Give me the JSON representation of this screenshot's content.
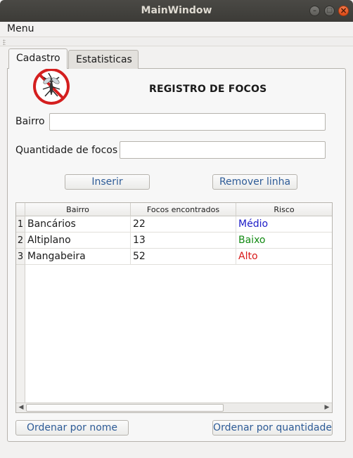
{
  "window": {
    "title": "MainWindow"
  },
  "menubar": {
    "menu_label": "Menu"
  },
  "tabs": [
    {
      "label": "Cadastro",
      "active": true
    },
    {
      "label": "Estatisticas",
      "active": false
    }
  ],
  "form": {
    "heading": "REGISTRO DE FOCOS",
    "bairro_label": "Bairro",
    "bairro_value": "",
    "quantidade_label": "Quantidade de focos",
    "quantidade_value": "",
    "insert_button": "Inserir",
    "remove_button": "Remover linha"
  },
  "table": {
    "columns": [
      "Bairro",
      "Focos encontrados",
      "Risco"
    ],
    "rows": [
      {
        "index": "1",
        "bairro": "Bancários",
        "focos": "22",
        "risco": "Médio",
        "risco_color": "#1c1cc8"
      },
      {
        "index": "2",
        "bairro": "Altiplano",
        "focos": "13",
        "risco": "Baixo",
        "risco_color": "#138a13"
      },
      {
        "index": "3",
        "bairro": "Mangabeira",
        "focos": "52",
        "risco": "Alto",
        "risco_color": "#d81818"
      }
    ]
  },
  "bottom_buttons": {
    "sort_name": "Ordenar por nome",
    "sort_quantity": "Ordenar por quantidade"
  },
  "colors": {
    "accent_text": "#2d5b97",
    "titlebar": "#3c3b37",
    "close_button": "#e9541d"
  },
  "icons": [
    "mosquito-prohibited-icon",
    "minimize-icon",
    "maximize-icon",
    "close-icon",
    "scroll-left-icon",
    "scroll-right-icon"
  ]
}
